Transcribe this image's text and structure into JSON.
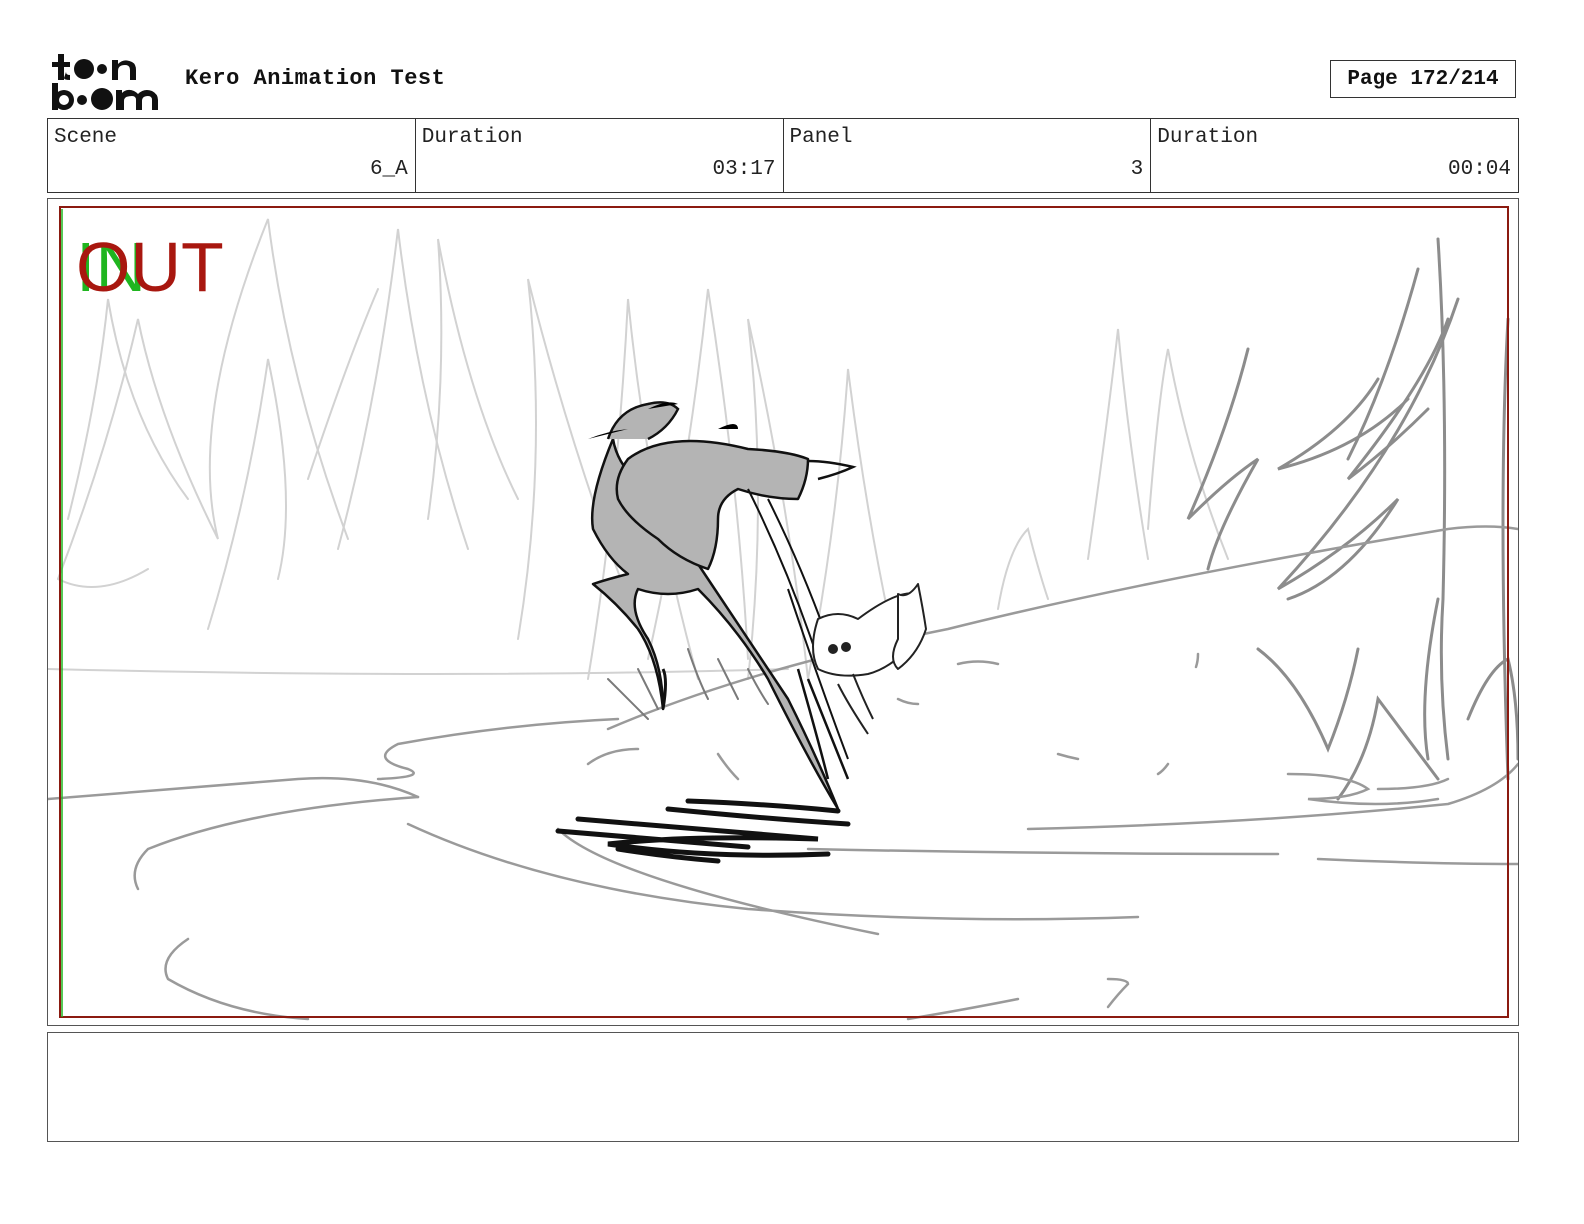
{
  "header": {
    "logo_name": "toon-boom-logo",
    "title": "Kero Animation Test",
    "page_label": "Page 172/214"
  },
  "info": {
    "scene_label": "Scene",
    "scene_value": "6_A",
    "scene_duration_label": "Duration",
    "scene_duration_value": "03:17",
    "panel_label": "Panel",
    "panel_value": "3",
    "panel_duration_label": "Duration",
    "panel_duration_value": "00:04"
  },
  "panel": {
    "in_marker": "IN",
    "out_marker": "OUT",
    "in_color": "#1fb51f",
    "out_color": "#a8170f",
    "safe_frame_color": "#8b1a10"
  },
  "notes": {
    "text": ""
  }
}
